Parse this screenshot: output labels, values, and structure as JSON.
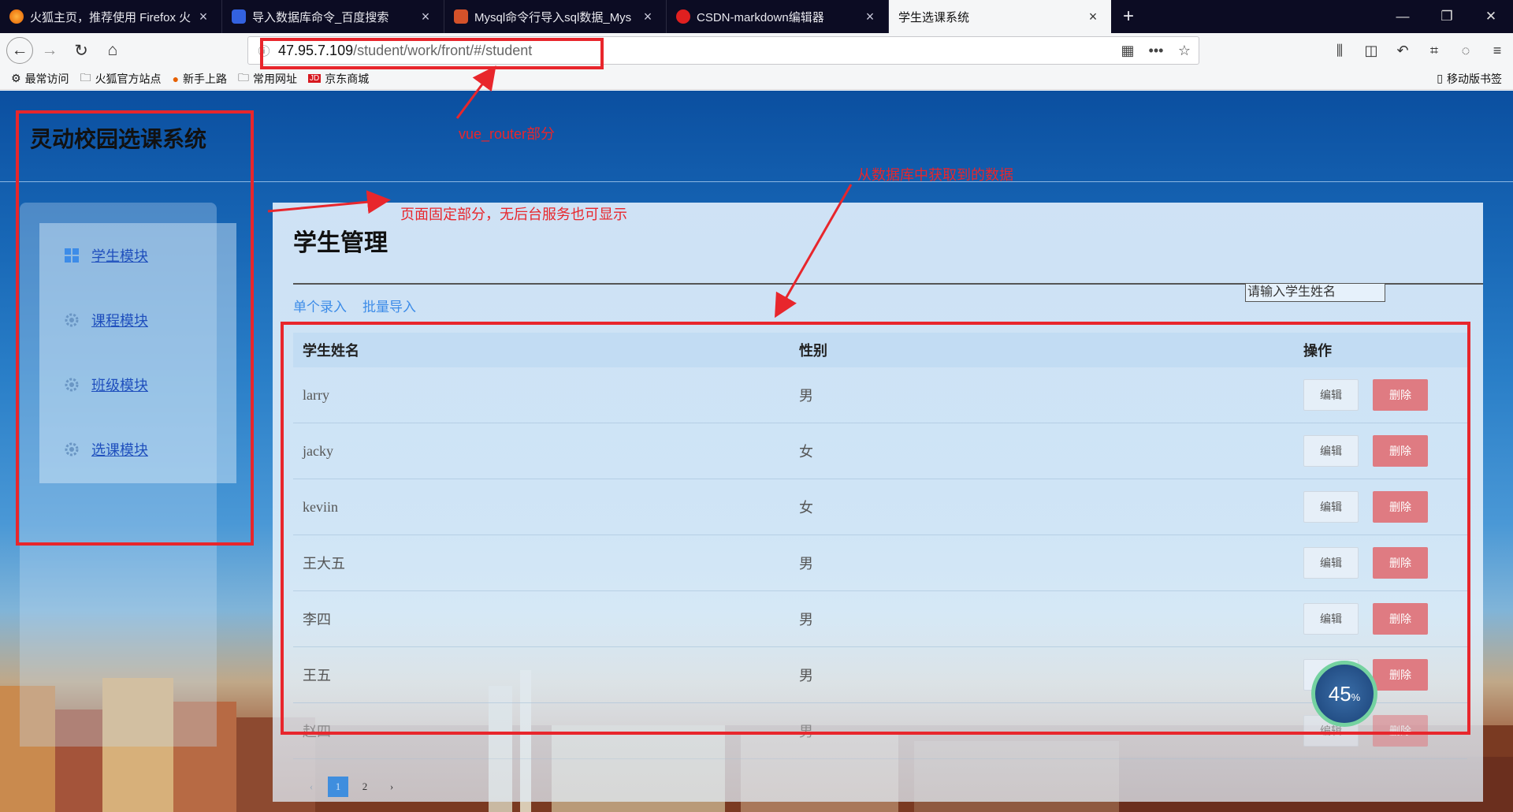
{
  "browser": {
    "tabs": [
      {
        "label": "火狐主页，推荐使用 Firefox 火",
        "favicon_color": "#e66000"
      },
      {
        "label": "导入数据库命令_百度搜索",
        "favicon_color": "#3362e0"
      },
      {
        "label": "Mysql命令行导入sql数据_Mys",
        "favicon_color": "#d4522a"
      },
      {
        "label": "CSDN-markdown编辑器",
        "favicon_color": "#e02020"
      },
      {
        "label": "学生选课系统",
        "favicon_color": ""
      }
    ],
    "url_host": "47.95.7.109",
    "url_path": "/student/work/front/#/student",
    "bookmarks": [
      "最常访问",
      "火狐官方站点",
      "新手上路",
      "常用网址",
      "京东商城"
    ],
    "mobile_bookmarks": "移动版书签"
  },
  "app": {
    "title": "灵动校园选课系统",
    "sidebar": [
      {
        "label": "学生模块",
        "icon": "grid-icon"
      },
      {
        "label": "课程模块",
        "icon": "gear-icon"
      },
      {
        "label": "班级模块",
        "icon": "gear-icon"
      },
      {
        "label": "选课模块",
        "icon": "gear-icon"
      }
    ],
    "main_title": "学生管理",
    "actions": {
      "single": "单个录入",
      "batch": "批量导入"
    },
    "search_placeholder": "请输入学生姓名",
    "table": {
      "headers": [
        "学生姓名",
        "性别",
        "操作"
      ],
      "edit_label": "编辑",
      "delete_label": "删除",
      "rows": [
        {
          "name": "larry",
          "gender": "男"
        },
        {
          "name": "jacky",
          "gender": "女"
        },
        {
          "name": "keviin",
          "gender": "女"
        },
        {
          "name": "王大五",
          "gender": "男"
        },
        {
          "name": "李四",
          "gender": "男"
        },
        {
          "name": "王五",
          "gender": "男"
        },
        {
          "name": "赵四",
          "gender": "男"
        }
      ]
    },
    "pager": {
      "prev": "‹",
      "current": "1",
      "next_page": "2",
      "next": "›"
    }
  },
  "overlay": {
    "gauge_percent": "45",
    "gauge_unit": "%",
    "notes": {
      "router": "vue_router部分",
      "fixed": "页面固定部分，无后台服务也可显示",
      "db": "从数据库中获取到的数据"
    }
  },
  "colors": {
    "annotation": "#e8262c",
    "link": "#3d8ce8",
    "delete": "#df7b82"
  }
}
